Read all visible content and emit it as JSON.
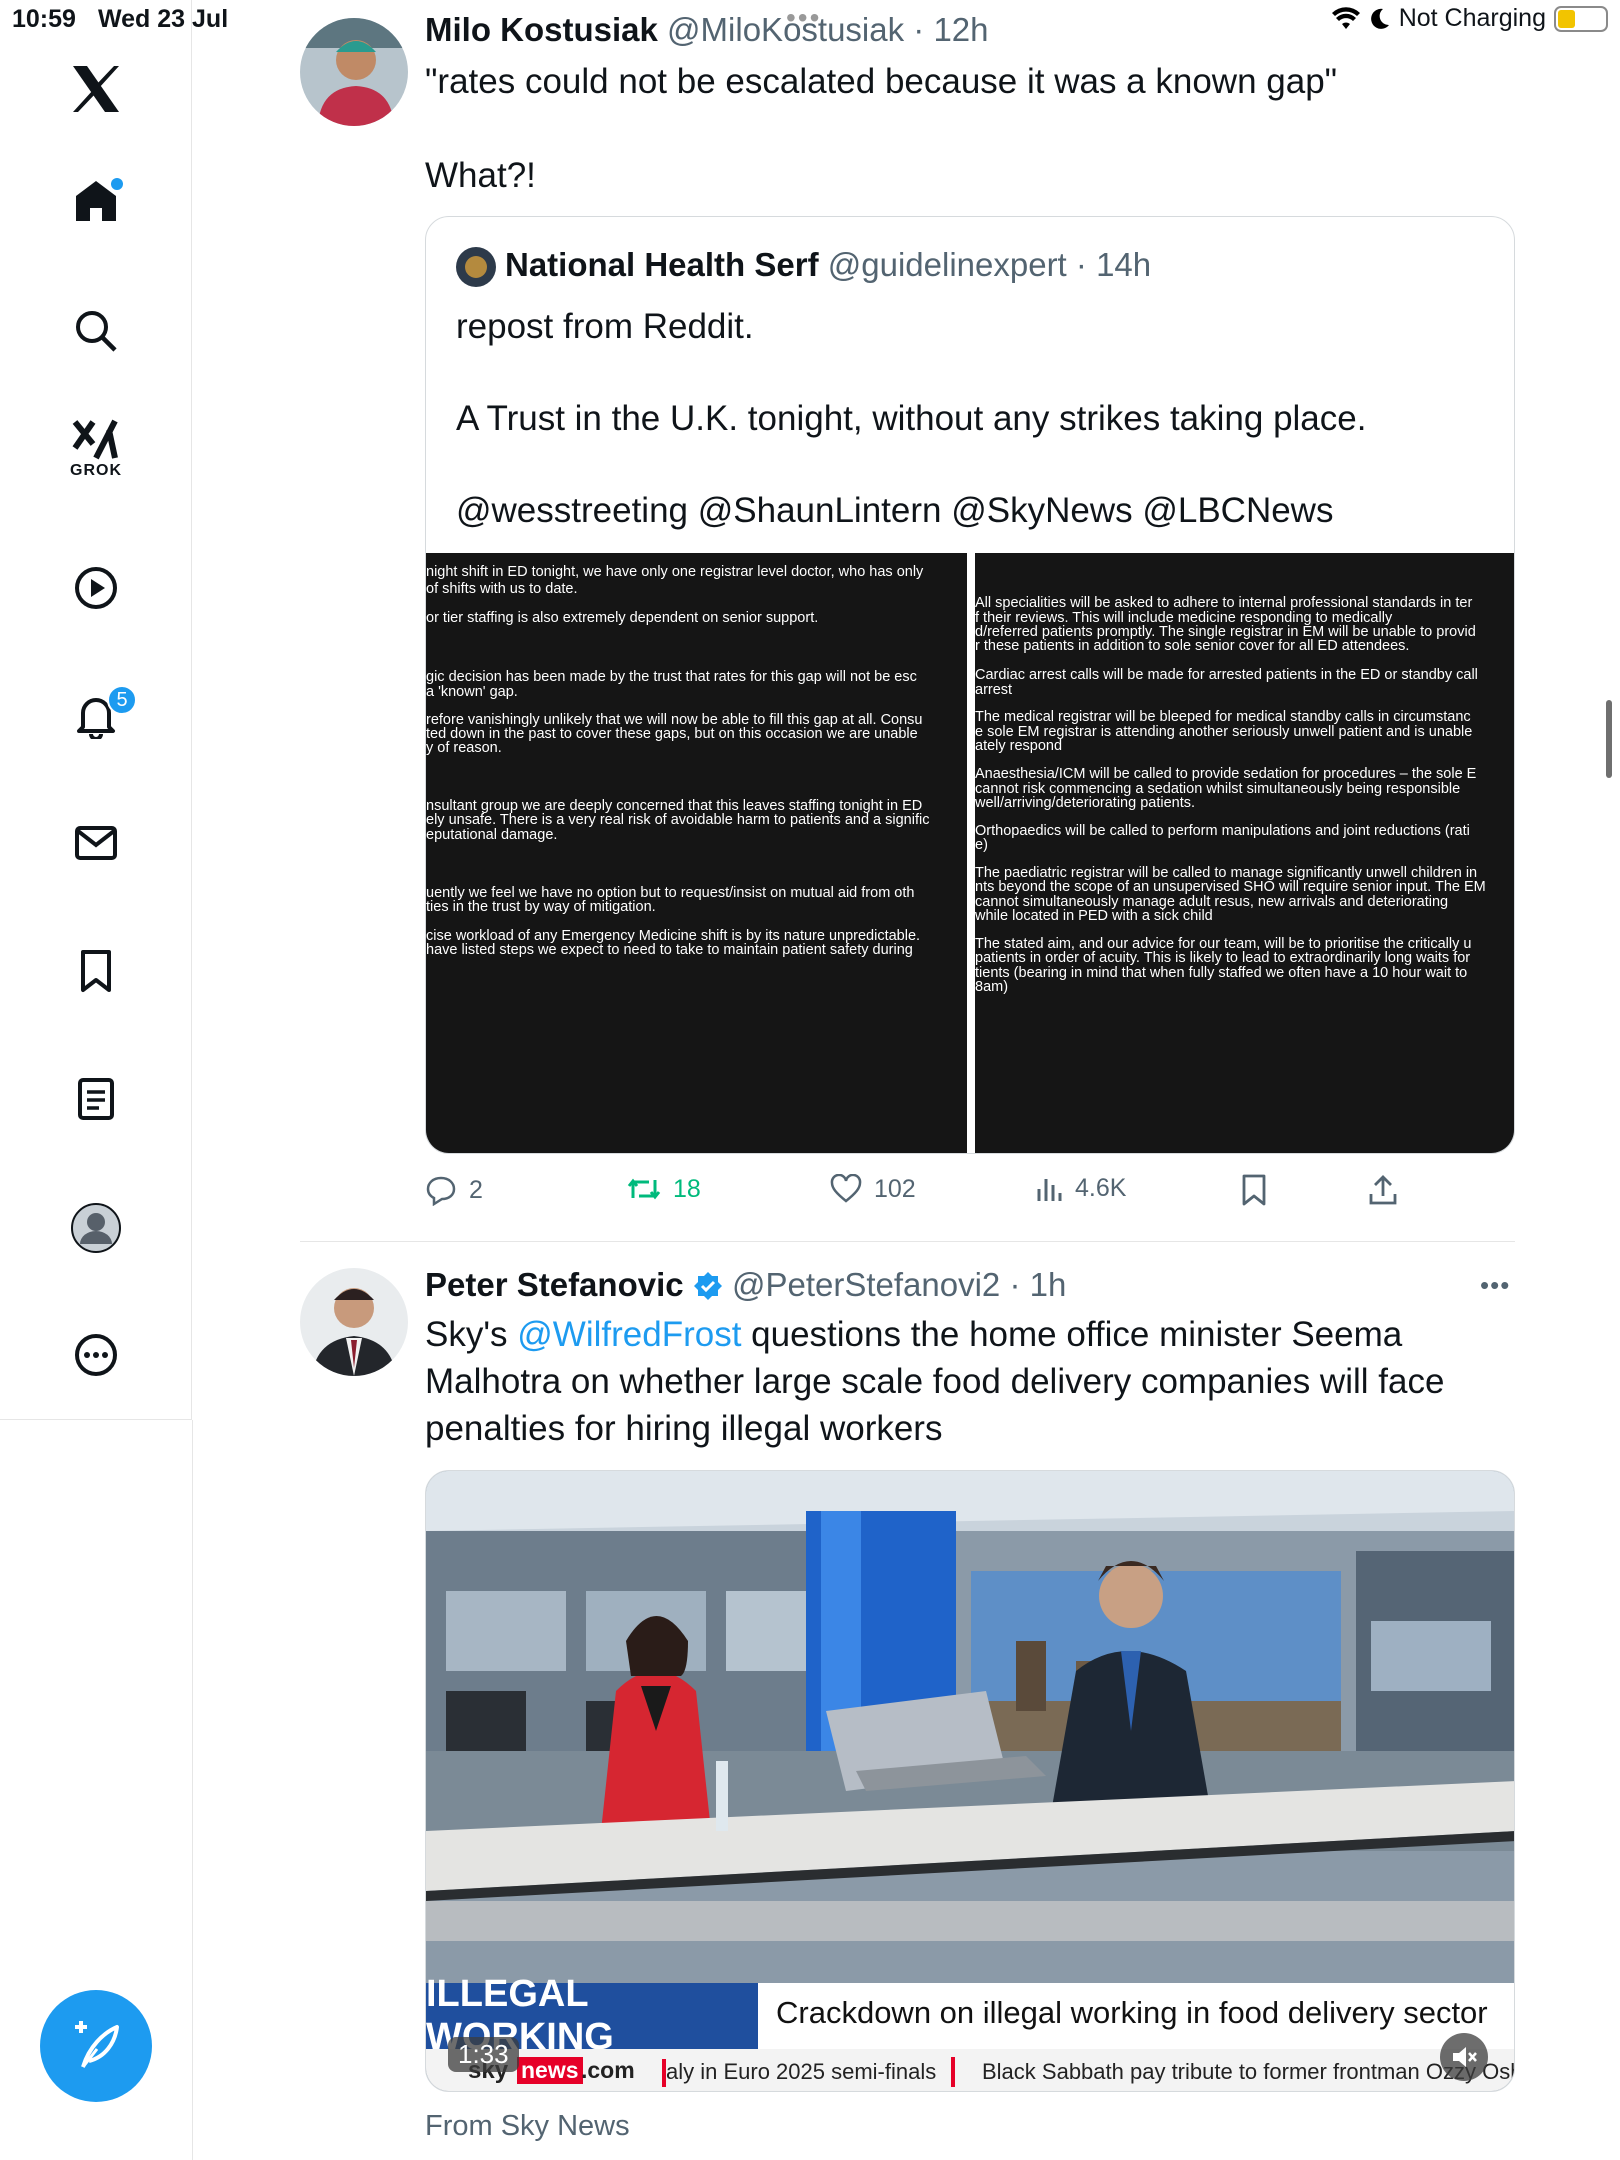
{
  "status": {
    "time": "10:59",
    "date": "Wed 23 Jul",
    "battery": "Not Charging"
  },
  "nav": {
    "grok_label": "GROK",
    "notifications_count": "5"
  },
  "tweet1": {
    "name": "Milo Kostusiak",
    "handle": "@MiloKostusiak",
    "time": "· 12h",
    "line1": "\"rates could not be escalated because it was a known gap\"",
    "line2": "What?!"
  },
  "quote": {
    "name": "National Health Serf",
    "handle": "@guidelinexpert",
    "time": "· 14h",
    "line1": "repost from Reddit.",
    "line2": "A Trust in the U.K. tonight, without any strikes taking place.",
    "line3": "@wesstreeting @ShaunLintern @SkyNews @LBCNews"
  },
  "doc_left": [
    "night shift in ED tonight, we have only one registrar level doctor, who has only",
    "of shifts with us to date.",
    "or tier staffing is also  extremely dependent on senior support.",
    "gic decision has been made by the trust that rates for this gap will not be esc",
    "a 'known' gap.",
    "refore vanishingly unlikely that we will now be able to fill this gap at all. Consu",
    "ted down in the past to cover these gaps, but on this occasion we are unable",
    "y of reason.",
    "nsultant group we are deeply concerned that this leaves staffing tonight in ED",
    "ely unsafe. There is a very real risk of avoidable harm to patients and a signific",
    "eputational damage.",
    "uently we feel we have no option but to request/insist on mutual aid from oth",
    "ties in the trust by way of mitigation.",
    "cise workload of any Emergency Medicine shift is by its nature unpredictable.",
    "have listed steps we expect to need to take to maintain patient safety during"
  ],
  "doc_right": [
    "All specialities will be asked to adhere to internal professional standards in ter",
    "f their reviews. This will include medicine responding to medically",
    "d/referred patients promptly. The single registrar in EM will be unable to provid",
    "r these patients in addition to sole senior cover for all ED attendees.",
    "Cardiac arrest calls will be made for arrested patients in the ED or standby call",
    "arrest",
    "The medical registrar will be bleeped for medical standby calls in circumstanc",
    "e sole EM registrar is attending another seriously unwell patient and is unable",
    "ately respond",
    "Anaesthesia/ICM will be called to provide sedation for procedures – the sole E",
    "cannot risk commencing a sedation whilst simultaneously being responsible",
    "well/arriving/deteriorating patients.",
    "Orthopaedics will be called to perform manipulations and joint reductions (rati",
    "e)",
    "The paediatric registrar will be called to manage significantly unwell children in",
    "nts beyond the scope of an unsupervised SHO will require senior input. The EM",
    "cannot simultaneously manage adult resus, new arrivals and deteriorating",
    "while located in PED with a sick child",
    "The stated aim, and our advice for our team, will be to prioritise the critically u",
    "patients in order of acuity. This is likely to lead to extraordinarily long waits for",
    "tients (bearing in mind that when fully staffed we often have a 10 hour wait to",
    "8am)"
  ],
  "actions": {
    "replies": "2",
    "reposts": "18",
    "likes": "102",
    "views": "4.6K"
  },
  "tweet2": {
    "name": "Peter Stefanovic",
    "handle": "@PeterStefanovi2",
    "time": "· 1h",
    "text_pre": "Sky's ",
    "mention": "@WilfredFrost",
    "text_post": " questions the home office minister Seema",
    "line2": "Malhotra on whether large scale food delivery companies will face",
    "line3": "penalties for hiring illegal workers",
    "source": "From Sky News"
  },
  "video": {
    "banner_tag": "ILLEGAL WORKING",
    "banner_text": "Crackdown on illegal working in food delivery sector",
    "duration": "1:33",
    "sky_logo_news": "news",
    ".com": ".com",
    "ticker1": "aly in Euro 2025 semi-finals",
    "ticker2": "Black Sabbath pay tribute to former frontman Ozzy Osb",
    "sky_prefix": "sky"
  },
  "colors": {
    "accent": "#1d9bf0",
    "repost": "#00ba7c",
    "banner_blue": "#1f4f9e"
  }
}
